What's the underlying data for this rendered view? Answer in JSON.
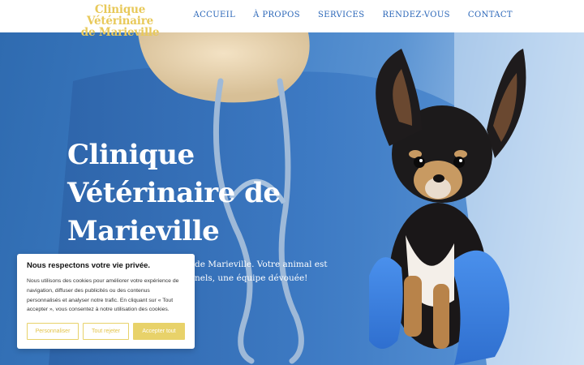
{
  "brand": {
    "line1": "Clinique Vétérinaire",
    "line2": "de Marieville"
  },
  "nav": {
    "items": [
      "ACCUEIL",
      "À PROPOS",
      "SERVICES",
      "RENDEZ-VOUS",
      "CONTACT"
    ]
  },
  "hero": {
    "title_line1": "Clinique",
    "title_line2": "Vétérinaire de",
    "title_line3": "Marieville",
    "text_line1": "de Marieville. Votre animal est",
    "text_line2": "nels, une équipe dévouée!"
  },
  "cookie": {
    "title": "Nous respectons votre vie privée.",
    "text": "Nous utilisons des cookies pour améliorer votre expérience de navigation, diffuser des publicités ou des contenus personnalisés et analyser notre trafic. En cliquant sur « Tout accepter », vous consentez à notre utilisation des cookies.",
    "btn_customize": "Personnaliser",
    "btn_reject": "Tout rejeter",
    "btn_accept": "Accepter tout"
  },
  "colors": {
    "brand_yellow": "#e8c95a",
    "nav_blue": "#2a66b8",
    "scrub_blue": "#2f6bb0",
    "glove_blue": "#3a7fe0"
  }
}
